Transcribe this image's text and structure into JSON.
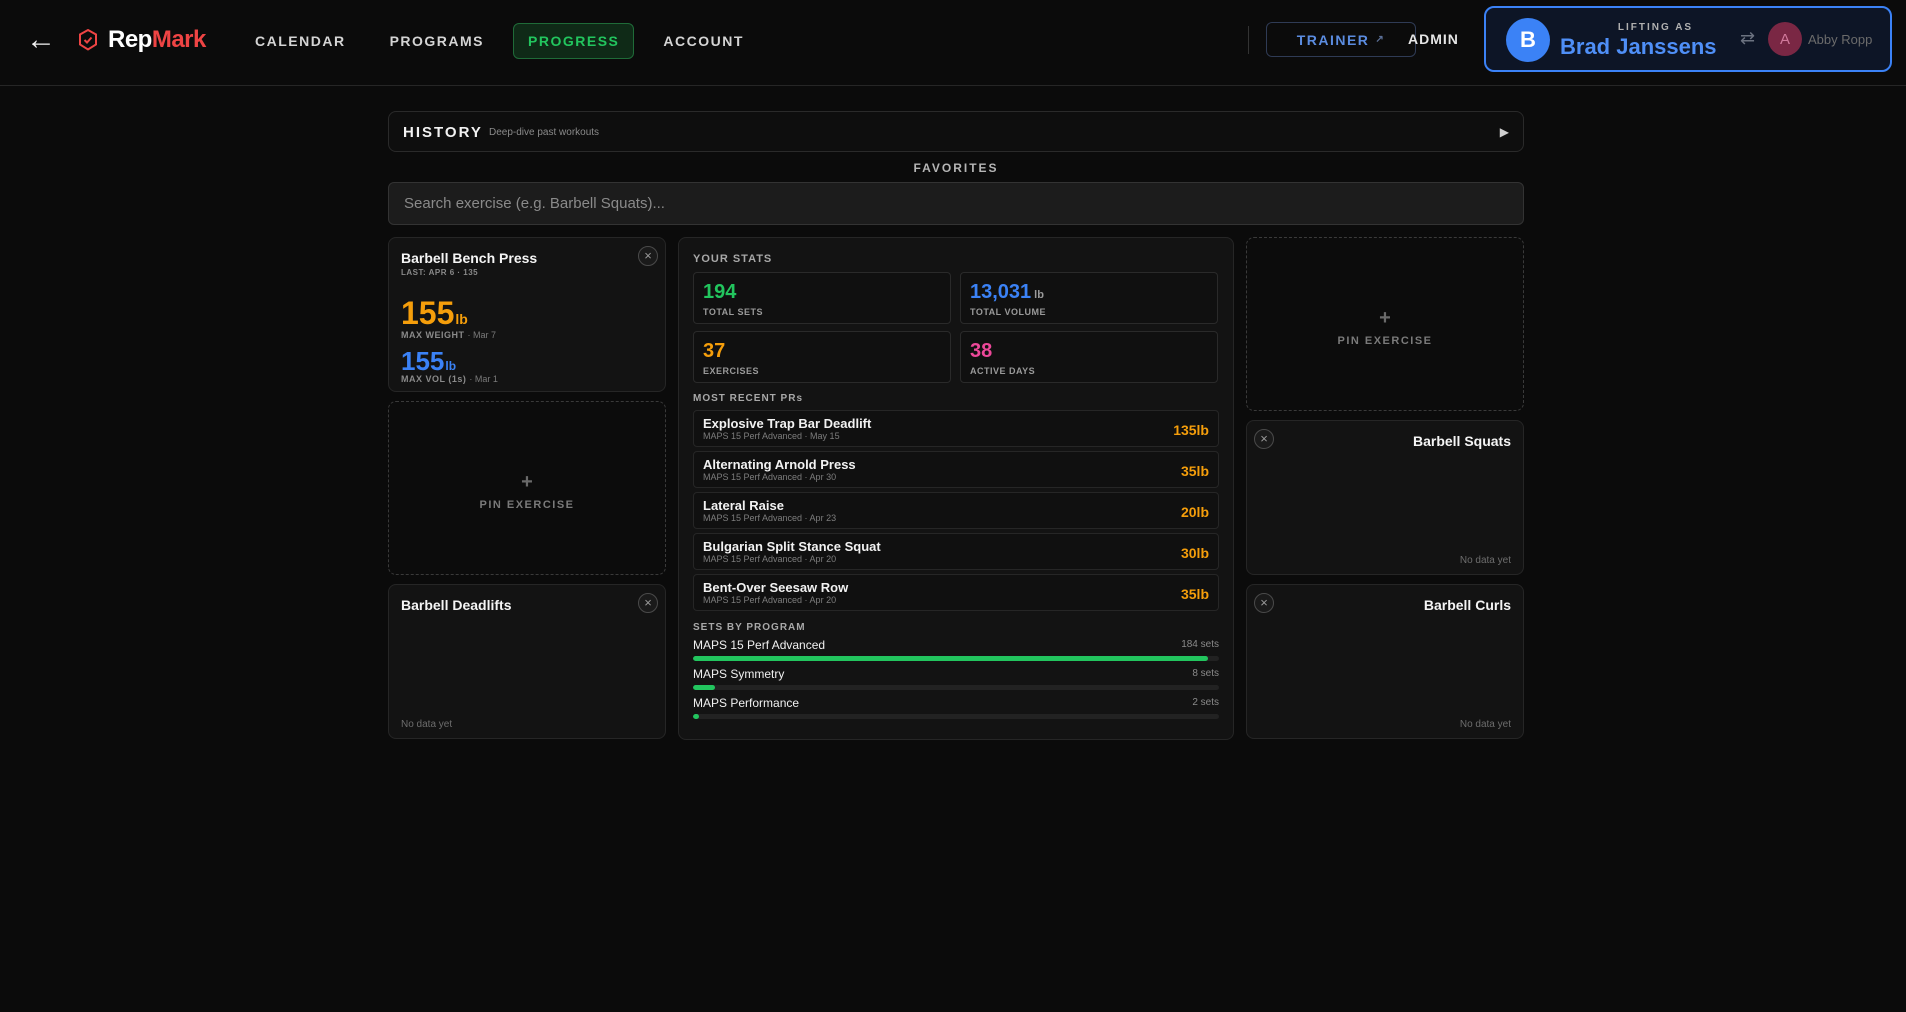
{
  "app": {
    "brand_part1": "Rep",
    "brand_part2": "Mark",
    "back_icon": "←"
  },
  "nav": {
    "items": [
      {
        "label": "CALENDAR",
        "active": false
      },
      {
        "label": "PROGRAMS",
        "active": false
      },
      {
        "label": "PROGRESS",
        "active": true
      },
      {
        "label": "ACCOUNT",
        "active": false
      }
    ],
    "trainer_label": "TRAINER",
    "admin_label": "ADMIN"
  },
  "lifting": {
    "label": "LIFTING AS",
    "initial": "B",
    "name": "Brad Janssens",
    "alt_initial": "A",
    "alt_name": "Abby Ropp"
  },
  "history": {
    "title": "HISTORY",
    "subtitle": "Deep-dive past workouts"
  },
  "favorites": {
    "label": "FAVORITES",
    "search_placeholder": "Search exercise (e.g. Barbell Squats)..."
  },
  "cards": {
    "bench": {
      "title": "Barbell Bench Press",
      "last": "LAST: APR 6 · 135",
      "max_weight": "155",
      "max_weight_unit": "lb",
      "max_weight_label": "MAX WEIGHT",
      "max_weight_date": "· Mar 7",
      "max_vol": "155",
      "max_vol_unit": "lb",
      "max_vol_label": "MAX VOL (1s)",
      "max_vol_date": "· Mar 1"
    },
    "pin_plus": "+",
    "pin_label": "PIN EXERCISE",
    "deadlifts": {
      "title": "Barbell Deadlifts",
      "no_data": "No data yet"
    },
    "squats": {
      "title": "Barbell Squats",
      "no_data": "No data yet"
    },
    "curls": {
      "title": "Barbell Curls",
      "no_data": "No data yet"
    },
    "close_glyph": "×"
  },
  "stats": {
    "title": "YOUR STATS",
    "total_sets": "194",
    "total_sets_label": "TOTAL SETS",
    "total_volume": "13,031",
    "total_volume_unit": "lb",
    "total_volume_label": "TOTAL VOLUME",
    "exercises": "37",
    "exercises_label": "EXERCISES",
    "active_days": "38",
    "active_days_label": "ACTIVE DAYS",
    "recent_prs_label": "MOST RECENT PRs",
    "prs": [
      {
        "name": "Explosive Trap Bar Deadlift",
        "meta": "MAPS 15 Perf Advanced · May 15",
        "value": "135lb"
      },
      {
        "name": "Alternating Arnold Press",
        "meta": "MAPS 15 Perf Advanced · Apr 30",
        "value": "35lb"
      },
      {
        "name": "Lateral Raise",
        "meta": "MAPS 15 Perf Advanced · Apr 23",
        "value": "20lb"
      },
      {
        "name": "Bulgarian Split Stance Squat",
        "meta": "MAPS 15 Perf Advanced · Apr 20",
        "value": "30lb"
      },
      {
        "name": "Bent-Over Seesaw Row",
        "meta": "MAPS 15 Perf Advanced · Apr 20",
        "value": "35lb"
      }
    ],
    "by_program_label": "SETS BY PROGRAM",
    "programs": [
      {
        "name": "MAPS 15 Perf Advanced",
        "sets": "184 sets",
        "count": 184
      },
      {
        "name": "MAPS Symmetry",
        "sets": "8 sets",
        "count": 8
      },
      {
        "name": "MAPS Performance",
        "sets": "2 sets",
        "count": 2
      }
    ]
  },
  "colors": {
    "accent_green": "#22c55e",
    "accent_blue": "#3b82f6",
    "accent_orange": "#f59e0b",
    "accent_pink": "#ec4899",
    "brand_red": "#ef4444"
  }
}
